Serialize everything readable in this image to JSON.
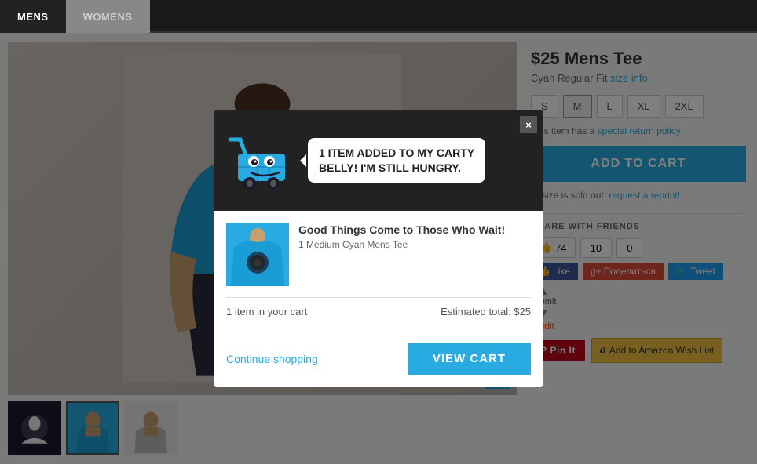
{
  "nav": {
    "tabs": [
      {
        "id": "mens",
        "label": "MENS",
        "active": true
      },
      {
        "id": "womens",
        "label": "WOMENS",
        "active": false
      }
    ]
  },
  "product": {
    "price": "$25",
    "title": "Mens Tee",
    "price_title": "$25 Mens Tee",
    "color": "Cyan Regular Fit",
    "size_info_link": "size info",
    "sizes": [
      "S",
      "M",
      "L",
      "XL",
      "2XL"
    ],
    "return_policy_text": "This item has a",
    "return_policy_link": "special return policy",
    "add_to_cart_label": "ADD TO CART",
    "soldout_text": "ur size is sold out,",
    "reprint_link": "request a reprint!",
    "share_label": "HARE WITH FRIENDS",
    "social": {
      "like_count": "74",
      "gplus_count": "10",
      "tweet_count": "0",
      "like_label": "Like",
      "gplus_label": "Поделиться",
      "tweet_label": "Tweet",
      "submit_label": "submit",
      "reddit_label": "reddit"
    },
    "wishlist_label": "Add to Amazon Wish List",
    "pinterest_label": "Pin It"
  },
  "modal": {
    "message_line1": "1 ITEM ADDED TO MY CARTY",
    "message_line2": "BELLY! I'M STILL HUNGRY.",
    "item_name": "Good Things Come to Those Who Wait!",
    "item_variant": "1 Medium Cyan Mens Tee",
    "cart_count_text": "1 item in your cart",
    "estimated_total_text": "Estimated total: $25",
    "continue_label": "Continue shopping",
    "view_cart_label": "VIEW CART",
    "close_label": "×"
  },
  "icons": {
    "expand": "expand-icon",
    "thumbup": "👍",
    "gplus": "g+",
    "bird": "🐦",
    "amazon": "a",
    "pin": "P",
    "arrow_up": "▲",
    "arrow_down": "▼"
  }
}
